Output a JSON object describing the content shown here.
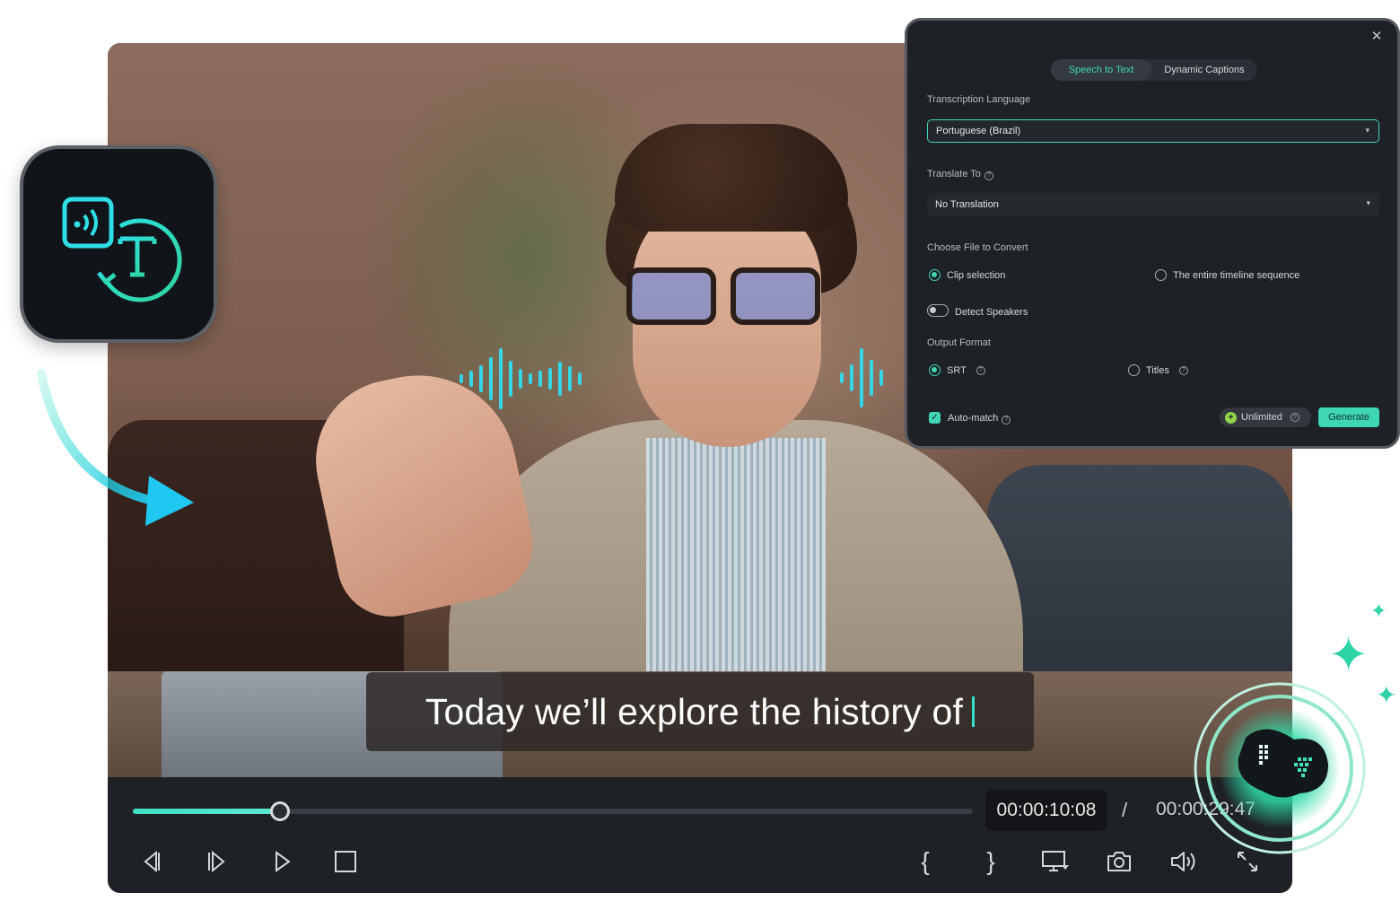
{
  "caption": {
    "text": "Today we’ll explore the history of"
  },
  "player": {
    "progress_fraction": 0.175,
    "time_current": "00:00:10:08",
    "time_separator": "/",
    "time_total": "00:00:29:47",
    "controls": [
      "previous-frame",
      "next-frame",
      "play",
      "stop",
      "mark-in",
      "mark-out",
      "display-settings",
      "snapshot",
      "volume",
      "fullscreen"
    ]
  },
  "dialog": {
    "tabs": [
      {
        "label": "Speech to Text",
        "active": true
      },
      {
        "label": "Dynamic Captions",
        "active": false
      }
    ],
    "transcription_language_label": "Transcription Language",
    "transcription_language_value": "Portuguese (Brazil)",
    "translate_to_label": "Translate To",
    "translate_to_value": "No Translation",
    "choose_file_label": "Choose File to Convert",
    "file_options": [
      {
        "label": "Clip selection",
        "selected": true
      },
      {
        "label": "The entire timeline sequence",
        "selected": false
      }
    ],
    "detect_speakers_label": "Detect Speakers",
    "output_format_label": "Output Format",
    "output_options": [
      {
        "label": "SRT",
        "selected": true
      },
      {
        "label": "Titles",
        "selected": false
      }
    ],
    "auto_match_label": "Auto-match",
    "unlimited_label": "Unlimited",
    "generate_label": "Generate"
  },
  "colors": {
    "accent": "#3ed6b3",
    "wave": "#35d6e6",
    "dialog_bg": "#1e2126"
  }
}
